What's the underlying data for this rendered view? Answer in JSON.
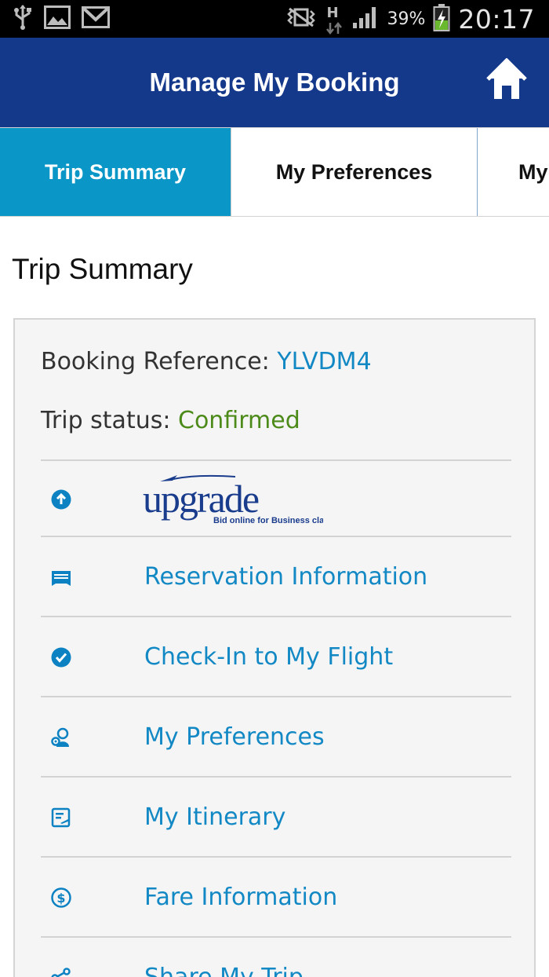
{
  "status_bar": {
    "battery_percent": "39%",
    "time": "20:17",
    "network_type": "H",
    "icons": [
      "usb-icon",
      "image-icon",
      "gmail-icon",
      "vibrate-icon",
      "network-h-icon",
      "signal-icon",
      "battery-charging-icon"
    ]
  },
  "header": {
    "title": "Manage My Booking",
    "home_icon": "home-icon"
  },
  "tabs": [
    {
      "label": "Trip Summary",
      "active": true
    },
    {
      "label": "My Preferences",
      "active": false
    },
    {
      "label": "My",
      "active": false
    }
  ],
  "page": {
    "heading": "Trip Summary"
  },
  "booking": {
    "reference_label": "Booking Reference: ",
    "reference_value": "YLVDM4",
    "status_label": "Trip status: ",
    "status_value": "Confirmed"
  },
  "upgrade_banner": {
    "logo_text": "upgrade",
    "tagline": "Bid online for Business class",
    "icon": "upgrade-arrow-icon"
  },
  "menu_items": [
    {
      "label": "Reservation Information",
      "icon": "ticket-icon"
    },
    {
      "label": "Check-In to My Flight",
      "icon": "check-circle-icon"
    },
    {
      "label": "My Preferences",
      "icon": "preferences-person-icon"
    },
    {
      "label": "My Itinerary",
      "icon": "itinerary-icon"
    },
    {
      "label": "Fare Information",
      "icon": "dollar-circle-icon"
    },
    {
      "label": "Share My Trip",
      "icon": "share-icon"
    }
  ],
  "colors": {
    "header_bg": "#15398a",
    "tab_active_bg": "#0a96c6",
    "link_blue": "#1288c4",
    "status_green": "#4c8a1a",
    "card_bg": "#f5f5f5"
  }
}
